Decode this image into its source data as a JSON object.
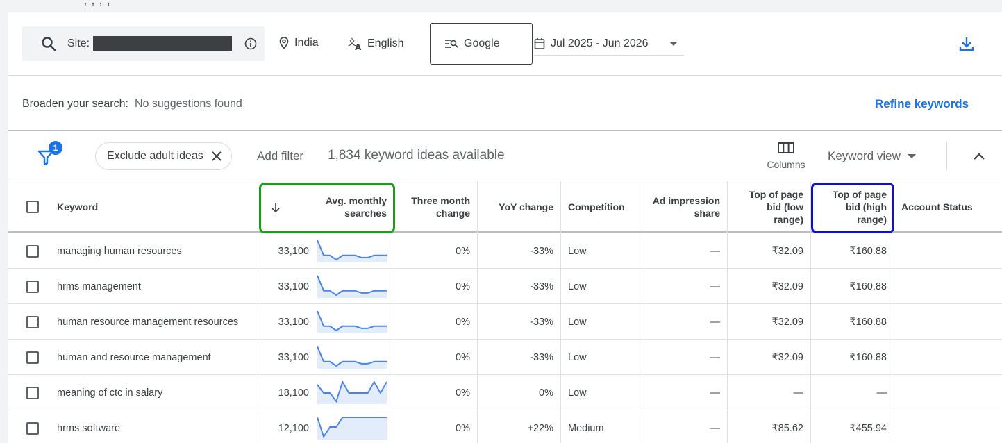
{
  "top": {
    "clipped_text": ", , ,  ,  "
  },
  "search": {
    "site_label": "Site:",
    "location": "India",
    "language": "English",
    "engine": "Google",
    "date_range": "Jul 2025 - Jun 2026"
  },
  "broaden": {
    "label": "Broaden your search:",
    "value": "No suggestions found",
    "refine": "Refine keywords"
  },
  "filters": {
    "badge_count": "1",
    "chip_label": "Exclude adult ideas",
    "add_filter": "Add filter",
    "ideas_count": "1,834 keyword ideas available",
    "columns_label": "Columns",
    "keyword_view": "Keyword view"
  },
  "table": {
    "headers": {
      "keyword": "Keyword",
      "avg_monthly_1": "Avg. monthly",
      "avg_monthly_2": "searches",
      "three_month_1": "Three month",
      "three_month_2": "change",
      "yoy": "YoY change",
      "competition": "Competition",
      "ad_impression_1": "Ad impression",
      "ad_impression_2": "share",
      "top_low_1": "Top of page",
      "top_low_2": "bid (low",
      "top_low_3": "range)",
      "top_high_1": "Top of page",
      "top_high_2": "bid (high",
      "top_high_3": "range)",
      "account_status": "Account Status"
    },
    "rows": [
      {
        "keyword": "managing human resources",
        "searches": "33,100",
        "three_month": "0%",
        "yoy": "-33%",
        "competition": "Low",
        "ad_share": "—",
        "bid_low": "₹32.09",
        "bid_high": "₹160.88",
        "trend": [
          10,
          3,
          3,
          1,
          3,
          3,
          3,
          2,
          2,
          3,
          3,
          3
        ]
      },
      {
        "keyword": "hrms management",
        "searches": "33,100",
        "three_month": "0%",
        "yoy": "-33%",
        "competition": "Low",
        "ad_share": "—",
        "bid_low": "₹32.09",
        "bid_high": "₹160.88",
        "trend": [
          10,
          3,
          3,
          1,
          3,
          3,
          3,
          2,
          2,
          3,
          3,
          3
        ]
      },
      {
        "keyword": "human resource management resources",
        "searches": "33,100",
        "three_month": "0%",
        "yoy": "-33%",
        "competition": "Low",
        "ad_share": "—",
        "bid_low": "₹32.09",
        "bid_high": "₹160.88",
        "trend": [
          10,
          3,
          3,
          1,
          3,
          3,
          3,
          2,
          2,
          3,
          3,
          3
        ]
      },
      {
        "keyword": "human and resource management",
        "searches": "33,100",
        "three_month": "0%",
        "yoy": "-33%",
        "competition": "Low",
        "ad_share": "—",
        "bid_low": "₹32.09",
        "bid_high": "₹160.88",
        "trend": [
          10,
          3,
          3,
          1,
          3,
          3,
          3,
          2,
          2,
          3,
          3,
          3
        ]
      },
      {
        "keyword": "meaning of ctc in salary",
        "searches": "18,100",
        "three_month": "0%",
        "yoy": "0%",
        "competition": "Low",
        "ad_share": "—",
        "bid_low": "—",
        "bid_high": "—",
        "trend": [
          7,
          4,
          4,
          1,
          8,
          4,
          4,
          4,
          4,
          8,
          4,
          8
        ]
      },
      {
        "keyword": "hrms software",
        "searches": "12,100",
        "three_month": "0%",
        "yoy": "+22%",
        "competition": "Medium",
        "ad_share": "—",
        "bid_low": "₹85.62",
        "bid_high": "₹455.94",
        "trend": [
          5,
          1,
          3,
          3,
          5,
          5,
          5,
          5,
          5,
          5,
          5,
          5
        ]
      }
    ]
  },
  "colors": {
    "accent": "#1a73e8",
    "spark_line": "#4a86e8",
    "spark_fill": "#e3ecfb",
    "highlight_green": "#1a9e1a",
    "highlight_blue": "#1010d0"
  }
}
